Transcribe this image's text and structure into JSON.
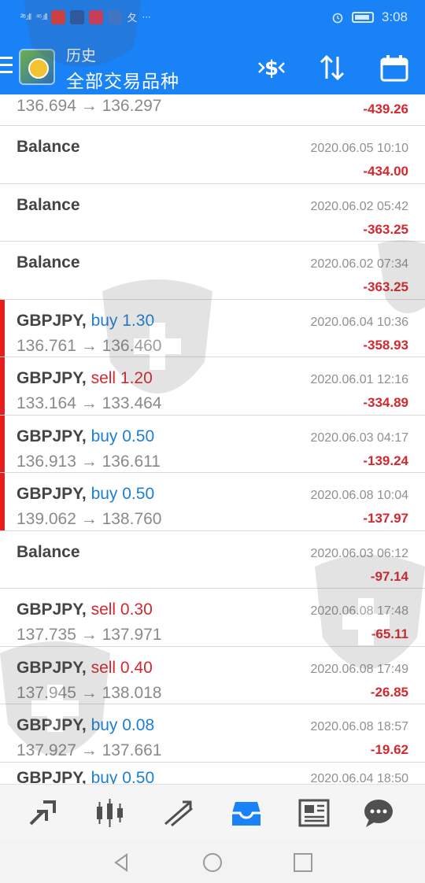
{
  "status_bar": {
    "signal1": "²⁶.ıll",
    "signal2": "⁴⁶.ıll",
    "extra": "⋯",
    "time": "3:08"
  },
  "header": {
    "title": "历史",
    "subtitle": "全部交易品种",
    "icons": [
      "menu-icon",
      "currency-exchange-icon",
      "sort-icon",
      "calendar-icon"
    ]
  },
  "list": {
    "first_row": {
      "prices": "136.694 → 136.297",
      "profit": "-439.26"
    },
    "rows": [
      {
        "type": "balance",
        "symbol": "Balance",
        "datetime": "2020.06.05 10:10",
        "profit": "-434.00"
      },
      {
        "type": "balance",
        "symbol": "Balance",
        "datetime": "2020.06.02 05:42",
        "profit": "-363.25"
      },
      {
        "type": "balance",
        "symbol": "Balance",
        "datetime": "2020.06.02 07:34",
        "profit": "-363.25"
      },
      {
        "type": "trade",
        "symbol": "GBPJPY,",
        "direction": "buy 1.30",
        "side": "buy",
        "prices": "136.761 → 136.460",
        "datetime": "2020.06.04 10:36",
        "profit": "-358.93",
        "bar": true
      },
      {
        "type": "trade",
        "symbol": "GBPJPY,",
        "direction": "sell 1.20",
        "side": "sell",
        "prices": "133.164 → 133.464",
        "datetime": "2020.06.01 12:16",
        "profit": "-334.89",
        "bar": true
      },
      {
        "type": "trade",
        "symbol": "GBPJPY,",
        "direction": "buy 0.50",
        "side": "buy",
        "prices": "136.913 → 136.611",
        "datetime": "2020.06.03 04:17",
        "profit": "-139.24",
        "bar": true
      },
      {
        "type": "trade",
        "symbol": "GBPJPY,",
        "direction": "buy 0.50",
        "side": "buy",
        "prices": "139.062 → 138.760",
        "datetime": "2020.06.08 10:04",
        "profit": "-137.97",
        "bar": true
      },
      {
        "type": "balance",
        "symbol": "Balance",
        "datetime": "2020.06.03 06:12",
        "profit": "-97.14"
      },
      {
        "type": "trade",
        "symbol": "GBPJPY,",
        "direction": "sell 0.30",
        "side": "sell",
        "prices": "137.735 → 137.971",
        "datetime": "2020.06.08 17:48",
        "profit": "-65.11"
      },
      {
        "type": "trade",
        "symbol": "GBPJPY,",
        "direction": "sell 0.40",
        "side": "sell",
        "prices": "137.945 → 138.018",
        "datetime": "2020.06.08 17:49",
        "profit": "-26.85"
      },
      {
        "type": "trade",
        "symbol": "GBPJPY,",
        "direction": "buy 0.08",
        "side": "buy",
        "prices": "137.927 → 137.661",
        "datetime": "2020.06.08 18:57",
        "profit": "-19.62"
      },
      {
        "type": "trade",
        "symbol": "GBPJPY,",
        "direction": "buy 0.50",
        "side": "buy",
        "datetime": "2020.06.04 18:50",
        "partial": true
      }
    ]
  },
  "bottom_nav": {
    "items": [
      "quotes-icon",
      "chart-icon",
      "trade-icon",
      "history-icon",
      "news-icon",
      "chat-icon"
    ],
    "active": "history-icon"
  },
  "system_nav": [
    "back-icon",
    "home-icon",
    "recents-icon"
  ],
  "colors": {
    "accent": "#1a82f7",
    "loss": "#d4282e",
    "buy": "#1c7fd6"
  }
}
